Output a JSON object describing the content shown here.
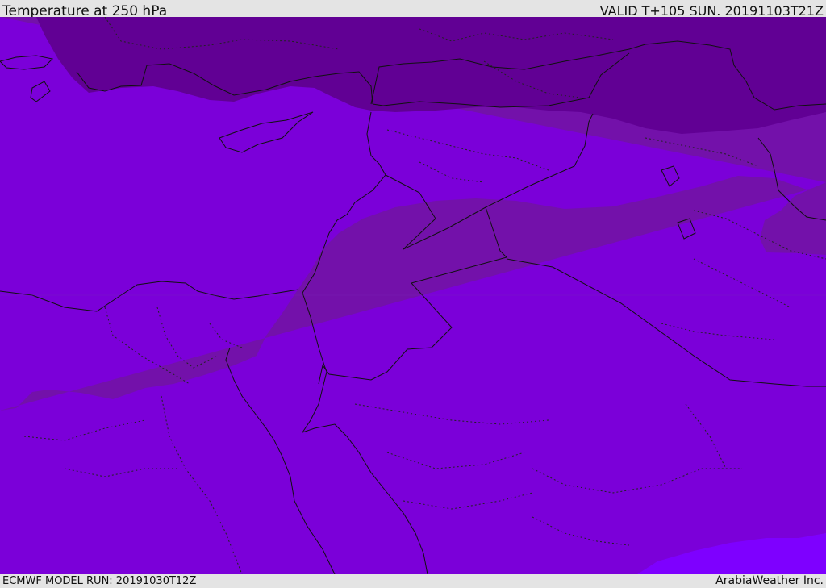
{
  "header": {
    "title": "Temperature at 250 hPa",
    "valid": "VALID T+105 SUN. 20191103T21Z"
  },
  "footer": {
    "model_run": "ECMWF MODEL RUN: 20191030T12Z",
    "credit": "ArabiaWeather Inc."
  },
  "map": {
    "colors": {
      "coldest": "#610094",
      "cold": "#7311aa",
      "mid": "#7b00d9",
      "warm": "#7e00ff",
      "border": "#111111"
    }
  }
}
